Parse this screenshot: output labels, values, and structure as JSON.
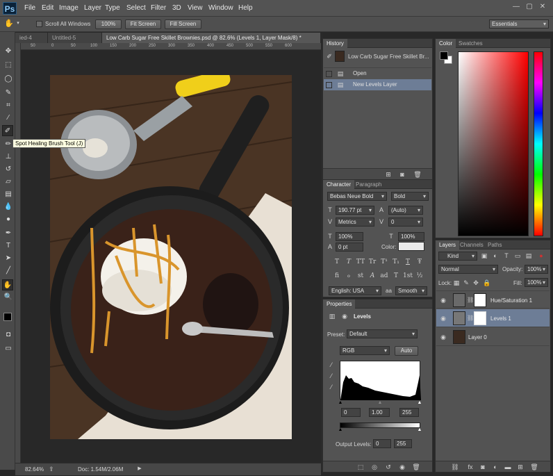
{
  "app": {
    "logo": "Ps"
  },
  "menu": [
    "File",
    "Edit",
    "Image",
    "Layer",
    "Type",
    "Select",
    "Filter",
    "3D",
    "View",
    "Window",
    "Help"
  ],
  "window_controls": {
    "minimize": "—",
    "maximize": "▢",
    "close": "✕"
  },
  "options": {
    "scroll_all_windows": "Scroll All Windows",
    "zoom_100": "100%",
    "fit_screen": "Fit Screen",
    "fill_screen": "Fill Screen",
    "workspace": "Essentials"
  },
  "doc_tabs": [
    {
      "label": "ied-4",
      "active": false
    },
    {
      "label": "Untitled-5",
      "active": false
    },
    {
      "label": "Low Carb Sugar Free Skillet Brownies.psd @ 82.6% (Levels 1, Layer Mask/8) *",
      "active": true
    }
  ],
  "ruler_h": [
    "50",
    "0",
    "50",
    "100",
    "150",
    "200",
    "250",
    "300",
    "350",
    "400",
    "450",
    "500",
    "550",
    "600"
  ],
  "tooltip": "Spot Healing Brush Tool (J)",
  "status": {
    "zoom": "82.64%",
    "doc": "Doc: 1.54M/2.06M"
  },
  "history": {
    "tab": "History",
    "snapshot": "Low Carb Sugar Free Skillet Br...",
    "items": [
      "Open",
      "New Levels Layer"
    ]
  },
  "character": {
    "tabs": [
      "Character",
      "Paragraph"
    ],
    "font": "Bebas Neue Bold",
    "style": "Bold",
    "size": "190.77 pt",
    "leading": "(Auto)",
    "kerning": "Metrics",
    "tracking": "0",
    "vscale": "100%",
    "hscale": "100%",
    "baseline": "0 pt",
    "color_label": "Color:",
    "type_buttons": [
      "T",
      "T",
      "TT",
      "Tr",
      "T¹",
      "T₁",
      "T",
      "Ŧ"
    ],
    "otf_buttons": [
      "fi",
      "ℴ",
      "st",
      "A",
      "ad",
      "T",
      "1st",
      "½"
    ],
    "language": "English: USA",
    "aa_icon": "aa",
    "antialias": "Smooth"
  },
  "properties": {
    "tab": "Properties",
    "title": "Levels",
    "preset_label": "Preset:",
    "preset": "Default",
    "channel": "RGB",
    "auto": "Auto",
    "input_black": "0",
    "input_mid": "1.00",
    "input_white": "255",
    "output_label": "Output Levels:",
    "output_black": "0",
    "output_white": "255"
  },
  "color_panel": {
    "tabs": [
      "Color",
      "Swatches"
    ],
    "fg": "#000000",
    "bg": "#ffffff"
  },
  "layers": {
    "tabs": [
      "Layers",
      "Channels",
      "Paths"
    ],
    "kind": "Kind",
    "blend": "Normal",
    "opacity_label": "Opacity:",
    "opacity": "100%",
    "lock_label": "Lock:",
    "fill_label": "Fill:",
    "fill": "100%",
    "rows": [
      {
        "name": "Hue/Saturation 1",
        "selected": false
      },
      {
        "name": "Levels 1",
        "selected": true
      },
      {
        "name": "Layer 0",
        "selected": false
      }
    ]
  },
  "colors": {
    "accent_selected": "#6d7d96",
    "panel": "#535353"
  }
}
